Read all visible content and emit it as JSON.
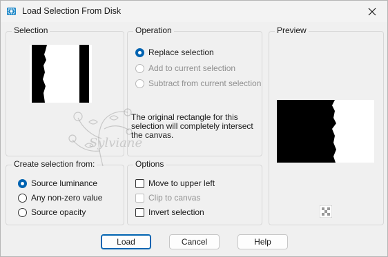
{
  "window": {
    "title": "Load Selection From Disk"
  },
  "selection_group": {
    "label": "Selection"
  },
  "operation_group": {
    "label": "Operation",
    "options": [
      {
        "label": "Replace selection",
        "checked": true,
        "enabled": true
      },
      {
        "label": "Add to current selection",
        "checked": false,
        "enabled": false
      },
      {
        "label": "Subtract from current selection",
        "checked": false,
        "enabled": false
      }
    ],
    "info_text": "The original rectangle for this selection will completely intersect the canvas."
  },
  "preview_group": {
    "label": "Preview"
  },
  "create_group": {
    "label": "Create selection from:",
    "options": [
      {
        "label": "Source luminance",
        "checked": true
      },
      {
        "label": "Any non-zero value",
        "checked": false
      },
      {
        "label": "Source opacity",
        "checked": false
      }
    ]
  },
  "options_group": {
    "label": "Options",
    "options": [
      {
        "label": "Move to upper left",
        "checked": false,
        "enabled": true
      },
      {
        "label": "Clip to canvas",
        "checked": false,
        "enabled": false
      },
      {
        "label": "Invert selection",
        "checked": false,
        "enabled": true
      }
    ]
  },
  "watermark": "Sylviane",
  "buttons": {
    "load": "Load",
    "cancel": "Cancel",
    "help": "Help"
  },
  "icons": {
    "app": "selection-app-icon",
    "close": "close-icon",
    "checker": "transparency-checker-icon"
  },
  "colors": {
    "accent": "#0063b1",
    "dialog_bg": "#f0f0f0"
  }
}
